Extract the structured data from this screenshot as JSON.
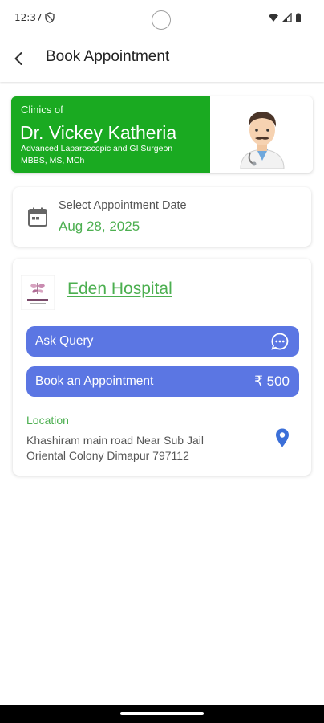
{
  "status_bar": {
    "time": "12:37"
  },
  "app_bar": {
    "title": "Book Appointment"
  },
  "doctor": {
    "clinics_of": "Clinics of",
    "name": "Dr. Vickey Katheria",
    "specialization": "Advanced Laparoscopic and GI Surgeon",
    "degrees": "MBBS, MS, MCh",
    "accent_color": "#1aaa21"
  },
  "appointment_date": {
    "label": "Select Appointment Date",
    "value": "Aug 28, 2025"
  },
  "hospital": {
    "name": "Eden Hospital",
    "ask_query_label": "Ask Query",
    "book_label": "Book an Appointment",
    "price": "₹ 500",
    "location_label": "Location",
    "address_line1": "Khashiram main road Near Sub Jail",
    "address_line2": "Oriental Colony Dimapur 797112",
    "button_color": "#5b76e3",
    "link_color": "#4caf50"
  },
  "icons": {
    "back": "back-arrow-icon",
    "calendar": "calendar-icon",
    "chat": "chat-bubble-icon",
    "location": "location-pin-icon"
  }
}
